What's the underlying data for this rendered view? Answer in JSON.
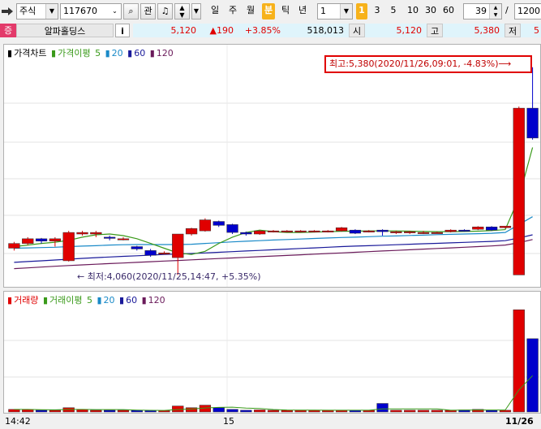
{
  "toolbar": {
    "market_type": "주식",
    "stock_code": "117670",
    "interest_label": "관",
    "periods": [
      "일",
      "주",
      "월",
      "분",
      "틱",
      "년"
    ],
    "active_period": "분",
    "interval_value": "1",
    "quick_intervals": [
      "1",
      "3",
      "5",
      "10",
      "30",
      "60"
    ],
    "active_interval": "1",
    "count_value": "39",
    "slash": "/",
    "total_value": "1200"
  },
  "quote": {
    "badge": "증",
    "stock_name": "알파홀딩스",
    "info_label": "i",
    "price": "5,120",
    "change": "▲190",
    "change_pct": "+3.85%",
    "volume": "518,013",
    "open_label": "시",
    "open_value": "5,120",
    "high_label": "고",
    "high_value": "5,380",
    "low_label": "저",
    "low_value": "5"
  },
  "price_legend": {
    "title": "가격차트",
    "ma_title": "가격이평",
    "ma_periods": [
      "5",
      "20",
      "60",
      "120"
    ]
  },
  "annotations": {
    "high": "최고:5,380(2020/11/26,09:01, -4.83%)⟶",
    "low": "← 최저:4,060(2020/11/25,14:47, +5.35%)"
  },
  "volume_legend": {
    "title": "거래량",
    "ma_title": "거래이평",
    "ma_periods": [
      "5",
      "20",
      "60",
      "120"
    ]
  },
  "xaxis": {
    "labels": [
      "14:42",
      "15",
      "11/26"
    ]
  },
  "colors": {
    "up": "#e00000",
    "down": "#0000cc",
    "ma5": "#3a9a1a",
    "ma20": "#1a8ac8",
    "ma60": "#1a1a9a",
    "ma120": "#6a1a5a"
  },
  "chart_data": {
    "type": "candlestick",
    "ylim": [
      4000,
      5420
    ],
    "candles": [
      {
        "o": 4230,
        "c": 4260,
        "h": 4270,
        "l": 4215
      },
      {
        "o": 4260,
        "c": 4290,
        "h": 4300,
        "l": 4250
      },
      {
        "o": 4290,
        "c": 4275,
        "h": 4295,
        "l": 4260
      },
      {
        "o": 4275,
        "c": 4290,
        "h": 4300,
        "l": 4240
      },
      {
        "o": 4150,
        "c": 4330,
        "h": 4340,
        "l": 4145
      },
      {
        "o": 4320,
        "c": 4330,
        "h": 4340,
        "l": 4310
      },
      {
        "o": 4320,
        "c": 4330,
        "h": 4340,
        "l": 4300
      },
      {
        "o": 4300,
        "c": 4295,
        "h": 4310,
        "l": 4280
      },
      {
        "o": 4290,
        "c": 4290,
        "h": 4300,
        "l": 4280
      },
      {
        "o": 4240,
        "c": 4225,
        "h": 4245,
        "l": 4215
      },
      {
        "o": 4215,
        "c": 4185,
        "h": 4225,
        "l": 4175
      },
      {
        "o": 4200,
        "c": 4200,
        "h": 4210,
        "l": 4190
      },
      {
        "o": 4170,
        "c": 4320,
        "h": 4320,
        "l": 4060
      },
      {
        "o": 4320,
        "c": 4355,
        "h": 4360,
        "l": 4310
      },
      {
        "o": 4340,
        "c": 4410,
        "h": 4420,
        "l": 4335
      },
      {
        "o": 4400,
        "c": 4375,
        "h": 4405,
        "l": 4365
      },
      {
        "o": 4380,
        "c": 4330,
        "h": 4385,
        "l": 4320
      },
      {
        "o": 4330,
        "c": 4320,
        "h": 4335,
        "l": 4310
      },
      {
        "o": 4320,
        "c": 4340,
        "h": 4345,
        "l": 4315
      },
      {
        "o": 4335,
        "c": 4340,
        "h": 4345,
        "l": 4330
      },
      {
        "o": 4335,
        "c": 4340,
        "h": 4345,
        "l": 4330
      },
      {
        "o": 4335,
        "c": 4340,
        "h": 4345,
        "l": 4330
      },
      {
        "o": 4340,
        "c": 4340,
        "h": 4345,
        "l": 4330
      },
      {
        "o": 4340,
        "c": 4340,
        "h": 4345,
        "l": 4330
      },
      {
        "o": 4340,
        "c": 4360,
        "h": 4365,
        "l": 4335
      },
      {
        "o": 4345,
        "c": 4325,
        "h": 4350,
        "l": 4320
      },
      {
        "o": 4340,
        "c": 4340,
        "h": 4345,
        "l": 4330
      },
      {
        "o": 4345,
        "c": 4335,
        "h": 4350,
        "l": 4310
      },
      {
        "o": 4335,
        "c": 4335,
        "h": 4340,
        "l": 4320
      },
      {
        "o": 4335,
        "c": 4335,
        "h": 4340,
        "l": 4320
      },
      {
        "o": 4330,
        "c": 4330,
        "h": 4340,
        "l": 4320
      },
      {
        "o": 4330,
        "c": 4330,
        "h": 4335,
        "l": 4325
      },
      {
        "o": 4335,
        "c": 4345,
        "h": 4350,
        "l": 4330
      },
      {
        "o": 4345,
        "c": 4340,
        "h": 4350,
        "l": 4335
      },
      {
        "o": 4350,
        "c": 4365,
        "h": 4370,
        "l": 4345
      },
      {
        "o": 4365,
        "c": 4345,
        "h": 4370,
        "l": 4340
      },
      {
        "o": 4360,
        "c": 4370,
        "h": 4370,
        "l": 4355
      },
      {
        "o": 4060,
        "c": 5120,
        "h": 5130,
        "l": 4930
      },
      {
        "o": 5120,
        "c": 4930,
        "h": 5380,
        "l": 4920
      }
    ],
    "ma5": [
      4240,
      4250,
      4260,
      4268,
      4280,
      4300,
      4315,
      4320,
      4310,
      4290,
      4260,
      4230,
      4200,
      4190,
      4210,
      4260,
      4300,
      4330,
      4345,
      4335,
      4330,
      4330,
      4332,
      4335,
      4337,
      4338,
      4340,
      4340,
      4340,
      4338,
      4336,
      4335,
      4335,
      4336,
      4338,
      4342,
      4348,
      4550,
      4870
    ],
    "ma20": [
      4230,
      4232,
      4234,
      4236,
      4240,
      4243,
      4246,
      4250,
      4252,
      4253,
      4253,
      4253,
      4253,
      4255,
      4260,
      4265,
      4270,
      4274,
      4278,
      4282,
      4285,
      4288,
      4292,
      4295,
      4298,
      4300,
      4303,
      4306,
      4308,
      4311,
      4313,
      4316,
      4318,
      4320,
      4322,
      4325,
      4330,
      4380,
      4430
    ],
    "ma60": [
      4140,
      4145,
      4150,
      4155,
      4160,
      4165,
      4170,
      4174,
      4178,
      4182,
      4186,
      4190,
      4193,
      4196,
      4200,
      4204,
      4208,
      4212,
      4216,
      4220,
      4224,
      4228,
      4232,
      4236,
      4240,
      4243,
      4246,
      4249,
      4252,
      4255,
      4258,
      4261,
      4264,
      4267,
      4270,
      4273,
      4278,
      4295,
      4315
    ],
    "ma120": [
      4100,
      4105,
      4110,
      4115,
      4120,
      4124,
      4128,
      4132,
      4136,
      4140,
      4144,
      4148,
      4152,
      4156,
      4160,
      4164,
      4168,
      4172,
      4176,
      4180,
      4184,
      4188,
      4192,
      4196,
      4200,
      4204,
      4208,
      4212,
      4216,
      4220,
      4224,
      4228,
      4232,
      4236,
      4240,
      4244,
      4250,
      4265,
      4285
    ],
    "volume": [
      1.5,
      1.5,
      1.0,
      1.0,
      2.5,
      1.5,
      1.0,
      1.0,
      1.0,
      1.0,
      0.8,
      0.8,
      3.5,
      2.5,
      4.0,
      2.5,
      1.5,
      1.0,
      1.2,
      1.0,
      1.0,
      1.0,
      1.0,
      1.0,
      1.0,
      1.0,
      1.0,
      5.0,
      1.0,
      1.0,
      1.0,
      1.0,
      1.0,
      1.2,
      1.5,
      1.0,
      1.0,
      60.0,
      43.0
    ],
    "vol_ylim": [
      0,
      62
    ]
  }
}
